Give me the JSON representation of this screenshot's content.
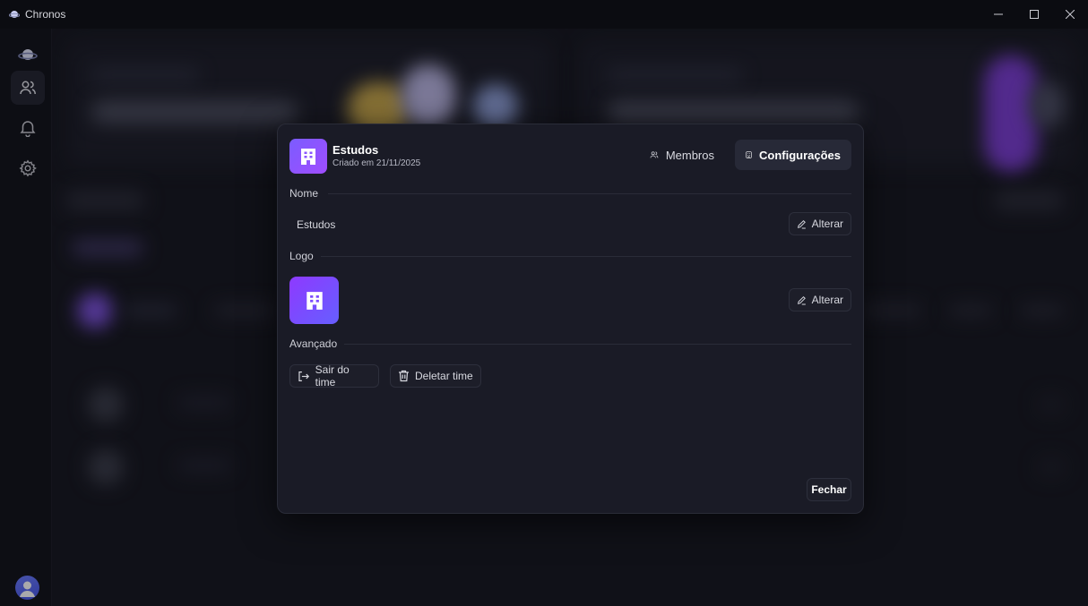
{
  "window": {
    "title": "Chronos",
    "controls": {
      "minimize": "–",
      "maximize": "▢",
      "close": "✕"
    }
  },
  "sidebar": {
    "items": [
      {
        "icon": "planet-logo-icon"
      },
      {
        "icon": "users-icon",
        "active": true
      },
      {
        "icon": "bell-icon"
      },
      {
        "icon": "gear-icon"
      }
    ],
    "avatar_icon": "user-avatar-icon"
  },
  "modal": {
    "team_name": "Estudos",
    "created_label": "Criado em 21/11/2025",
    "tabs": [
      {
        "label": "Membros",
        "icon": "users-icon",
        "active": false
      },
      {
        "label": "Configurações",
        "icon": "building-icon",
        "active": true
      }
    ],
    "sections": {
      "name": {
        "title": "Nome",
        "value": "Estudos",
        "action": "Alterar"
      },
      "logo": {
        "title": "Logo",
        "action": "Alterar"
      },
      "advanced": {
        "title": "Avançado",
        "leave": "Sair do time",
        "delete": "Deletar time"
      }
    },
    "close": "Fechar"
  },
  "colors": {
    "accent": "#7b5cff",
    "modal_bg": "#1a1b26",
    "app_bg": "#12131a"
  }
}
